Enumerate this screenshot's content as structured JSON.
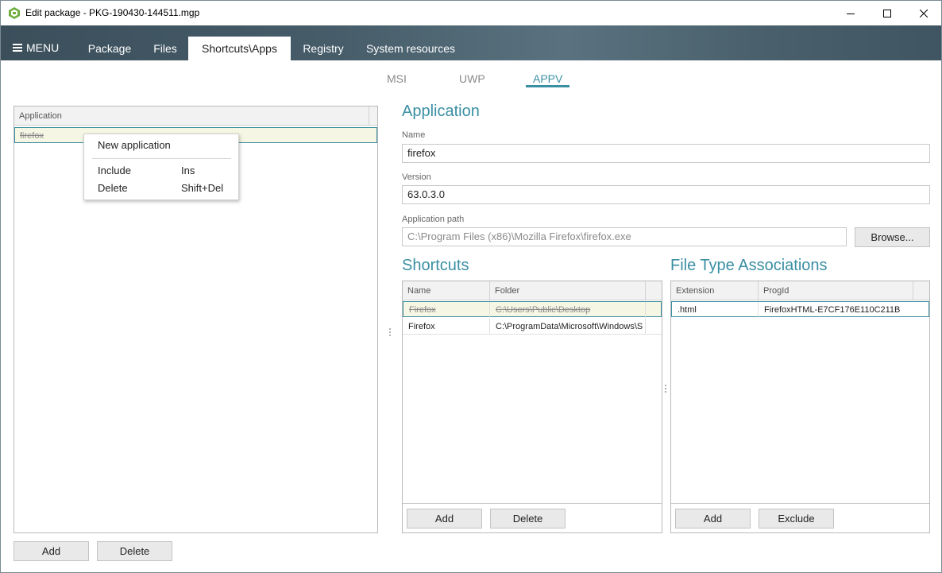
{
  "window": {
    "title": "Edit package - PKG-190430-144511.mgp"
  },
  "menu": {
    "label": "MENU"
  },
  "tabs": [
    {
      "label": "Package"
    },
    {
      "label": "Files"
    },
    {
      "label": "Shortcuts\\Apps"
    },
    {
      "label": "Registry"
    },
    {
      "label": "System resources"
    }
  ],
  "subtabs": [
    {
      "label": "MSI"
    },
    {
      "label": "UWP"
    },
    {
      "label": "APPV"
    }
  ],
  "app_list": {
    "header": "Application",
    "rows": [
      {
        "name": "firefox"
      }
    ],
    "add_label": "Add",
    "delete_label": "Delete"
  },
  "context_menu": {
    "items": [
      {
        "label": "New application",
        "shortcut": ""
      },
      {
        "label": "Include",
        "shortcut": "Ins"
      },
      {
        "label": "Delete",
        "shortcut": "Shift+Del"
      }
    ]
  },
  "application": {
    "title": "Application",
    "name_label": "Name",
    "name_value": "firefox",
    "version_label": "Version",
    "version_value": "63.0.3.0",
    "path_label": "Application path",
    "path_value": "C:\\Program Files (x86)\\Mozilla Firefox\\firefox.exe",
    "browse_label": "Browse..."
  },
  "shortcuts": {
    "title": "Shortcuts",
    "columns": [
      "Name",
      "Folder"
    ],
    "rows": [
      {
        "name": "Firefox",
        "folder": "C:\\Users\\Public\\Desktop"
      },
      {
        "name": "Firefox",
        "folder": "C:\\ProgramData\\Microsoft\\Windows\\S"
      }
    ],
    "add_label": "Add",
    "delete_label": "Delete"
  },
  "fta": {
    "title": "File Type Associations",
    "columns": [
      "Extension",
      "ProgId"
    ],
    "rows": [
      {
        "extension": ".html",
        "progid": "FirefoxHTML-E7CF176E110C211B"
      }
    ],
    "add_label": "Add",
    "exclude_label": "Exclude"
  },
  "colors": {
    "accent": "#3a8fa3",
    "band": "#465c69",
    "selection": "#f5f6e3"
  },
  "icons": [
    "app-package-icon",
    "minimize-icon",
    "maximize-icon",
    "close-icon",
    "menu-hamburger-icon"
  ]
}
